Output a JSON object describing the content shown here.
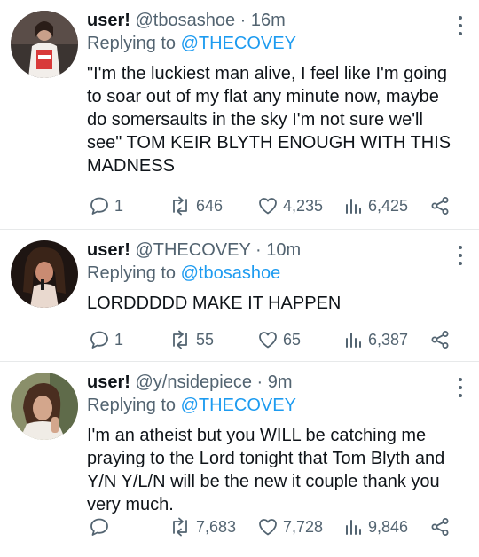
{
  "tweets": [
    {
      "username": "user!",
      "handle": "@tbosashoe",
      "separator": "·",
      "time": "16m",
      "replying_prefix": "Replying to",
      "replying_to": "@THECOVEY",
      "text": "\"I'm the luckiest man alive, I feel like I'm going to soar out of my flat any minute now, maybe do somersaults in the sky I'm not sure we'll see\" TOM KEIR BLYTH ENOUGH WITH THIS MADNESS",
      "replies": "1",
      "retweets": "646",
      "likes": "4,235",
      "views": "6,425"
    },
    {
      "username": "user!",
      "handle": "@THECOVEY",
      "separator": "·",
      "time": "10m",
      "replying_prefix": "Replying to",
      "replying_to": "@tbosashoe",
      "text": "LORDDDDD MAKE IT HAPPEN",
      "replies": "1",
      "retweets": "55",
      "likes": "65",
      "views": "6,387"
    },
    {
      "username": "user!",
      "handle": "@y/nsidepiece",
      "separator": "·",
      "time": "9m",
      "replying_prefix": "Replying to",
      "replying_to": "@THECOVEY",
      "text": "I'm an atheist but you WILL be catching me praying to the Lord tonight that Tom Blyth and Y/N Y/L/N will be the new it couple thank you very much.",
      "replies": "",
      "retweets": "7,683",
      "likes": "7,728",
      "views": "9,846"
    }
  ],
  "icons": {
    "reply": "reply-icon",
    "retweet": "retweet-icon",
    "like": "heart-icon",
    "views": "views-icon",
    "share": "share-icon",
    "more": "more-icon"
  },
  "colors": {
    "link": "#1d9bf0",
    "secondary": "#536471",
    "text": "#0f1419"
  }
}
